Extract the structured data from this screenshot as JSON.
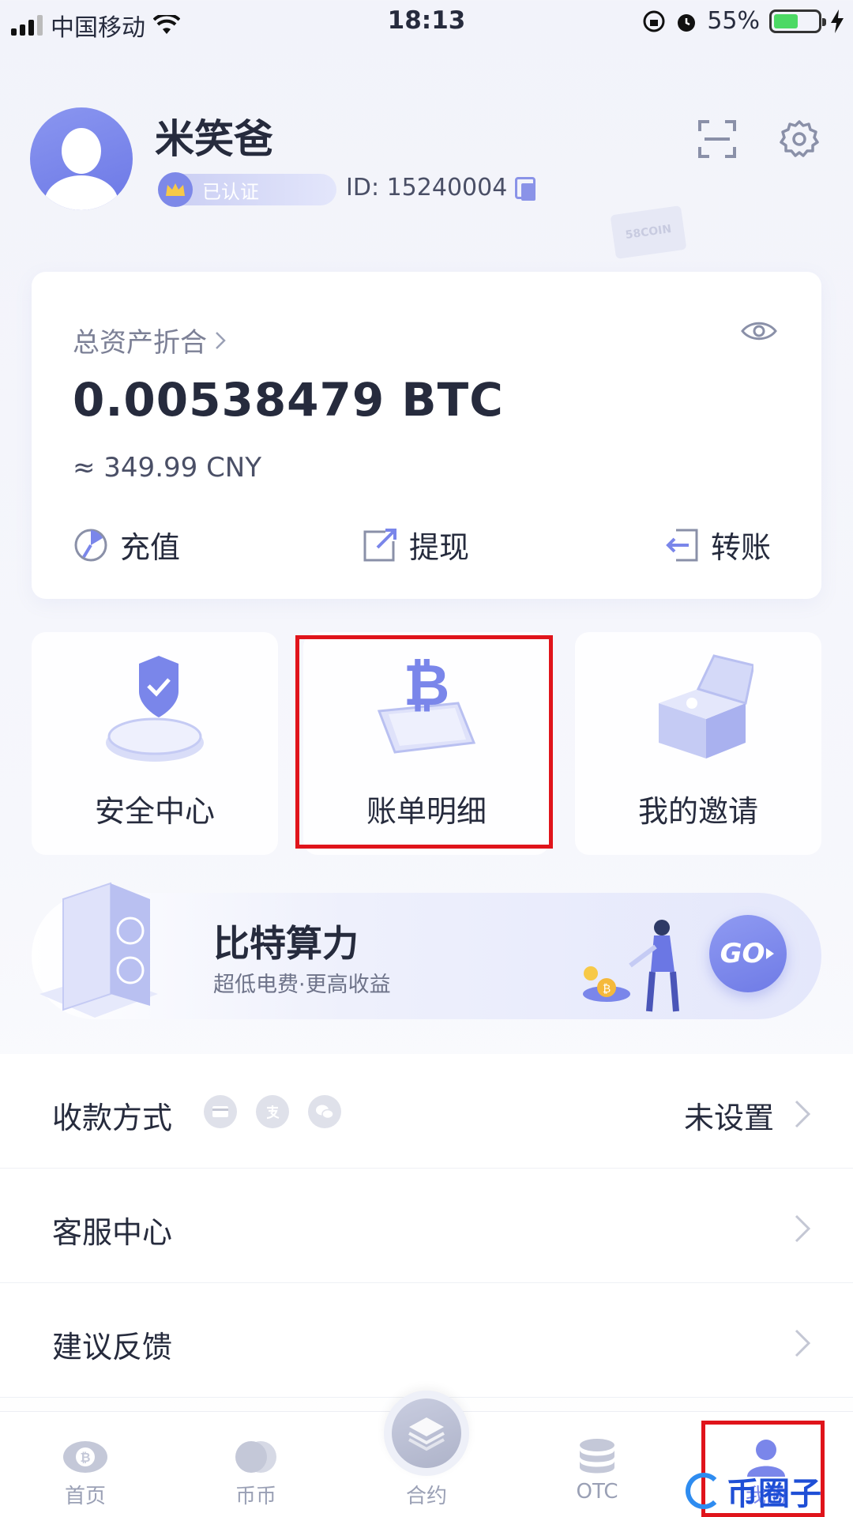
{
  "status_bar": {
    "carrier": "中国移动",
    "time": "18:13",
    "battery": "55%",
    "battery_level": 0.55
  },
  "profile": {
    "name": "米笑爸",
    "verified_badge": "已认证",
    "id_text": "ID: 15240004",
    "decor_flag_text": "58COIN"
  },
  "assets": {
    "title": "总资产折合",
    "btc_value": "0.00538479 BTC",
    "cny_value": "≈ 349.99 CNY",
    "actions": [
      {
        "label": "充值",
        "icon": "deposit-icon"
      },
      {
        "label": "提现",
        "icon": "withdraw-icon"
      },
      {
        "label": "转账",
        "icon": "transfer-icon"
      }
    ]
  },
  "tiles": [
    {
      "label": "安全中心",
      "icon": "shield-icon"
    },
    {
      "label": "账单明细",
      "icon": "bitcoin-phone-icon"
    },
    {
      "label": "我的邀请",
      "icon": "gift-box-icon"
    }
  ],
  "banner": {
    "title": "比特算力",
    "subtitle": "超低电费·更高收益",
    "go_label": "GO"
  },
  "list": {
    "payment": {
      "label": "收款方式",
      "value": "未设置"
    },
    "support": {
      "label": "客服中心"
    },
    "feedback": {
      "label": "建议反馈"
    }
  },
  "tabbar": {
    "home": "首页",
    "spot": "币币",
    "contract": "合约",
    "otc": "OTC",
    "mine": "我的"
  },
  "watermark": "币圈子",
  "colors": {
    "accent": "#7a86ea",
    "highlight_box": "#e0141b",
    "text": "#262b3d"
  }
}
